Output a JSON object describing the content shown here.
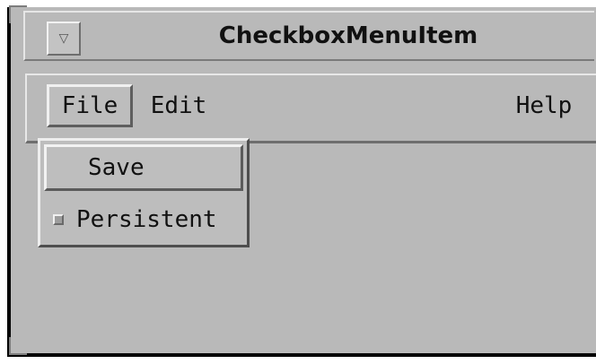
{
  "window": {
    "title": "CheckboxMenuItem",
    "menu_button_icon": "▽"
  },
  "menubar": {
    "items": [
      {
        "label": "File"
      },
      {
        "label": "Edit"
      },
      {
        "label": "Help"
      }
    ]
  },
  "dropdown": {
    "items": [
      {
        "label": "Save"
      },
      {
        "label": "Persistent",
        "type": "checkbox",
        "checked": false
      }
    ]
  },
  "colors": {
    "window_bg": "#b9b9b9",
    "border_dark": "#000000"
  }
}
